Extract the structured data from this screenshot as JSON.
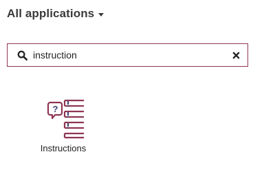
{
  "app_filter": {
    "label": "All applications",
    "caret_icon": "caret-down-icon"
  },
  "search": {
    "value": "instruction",
    "icon": "search-icon",
    "clear_icon": "close-icon"
  },
  "results": [
    {
      "label": "Instructions",
      "icon": "instructions-icon"
    }
  ],
  "colors": {
    "accent": "#8f3553",
    "text": "#3b3b3b"
  }
}
